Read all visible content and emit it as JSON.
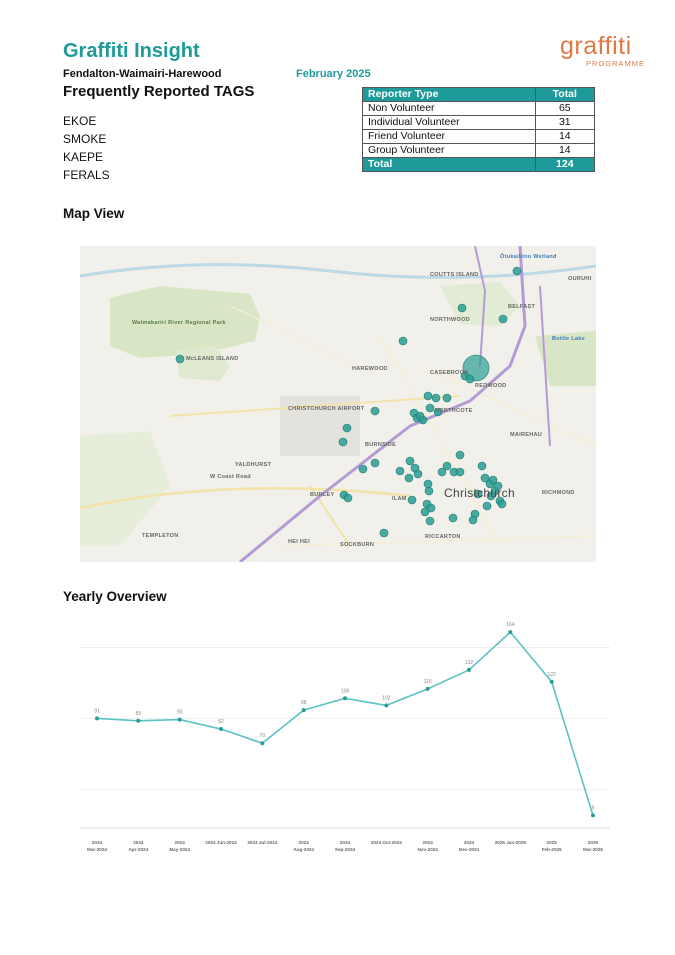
{
  "header": {
    "title": "Graffiti Insight",
    "area": "Fendalton-Waimairi-Harewood",
    "month": "February 2025",
    "logo_word": "graffiti",
    "logo_sub": "PROGRAMME"
  },
  "tags": {
    "heading": "Frequently Reported TAGS",
    "items": [
      "EKOE",
      "SMOKE",
      "KAEPE",
      "FERALS"
    ]
  },
  "reporter_table": {
    "headers": [
      "Reporter Type",
      "Total"
    ],
    "rows": [
      {
        "type": "Non Volunteer",
        "total": "65"
      },
      {
        "type": "Individual Volunteer",
        "total": "31"
      },
      {
        "type": "Friend Volunteer",
        "total": "14"
      },
      {
        "type": "Group Volunteer",
        "total": "14"
      }
    ],
    "total_label": "Total",
    "total_value": "124"
  },
  "map_section": {
    "heading": "Map View",
    "labels": [
      "Ōtukaikino Wetland",
      "COUTTS ISLAND",
      "OURUHI",
      "BELFAST",
      "NORTHWOOD",
      "Waimakariri River Regional Park",
      "Bottle Lake",
      "McLEANS ISLAND",
      "HAREWOOD",
      "CASEBROOK",
      "REDWOOD",
      "CHRISTCHURCH AIRPORT",
      "NORTHCOTE",
      "MAIREHAU",
      "BURNSIDE",
      "YALDHURST",
      "W Coast Road",
      "ILAM",
      "Christchurch",
      "RICHMOND",
      "BURLEY",
      "TEMPLETON",
      "HEI HEI",
      "SOCKBURN",
      "RICCARTON"
    ],
    "colors": {
      "marker": "#2a9d94",
      "motorway": "#b59bd6",
      "park": "#d8e6c5",
      "water": "#bcd9e8"
    }
  },
  "yearly_section": {
    "heading": "Yearly Overview"
  },
  "chart_data": {
    "type": "line",
    "categories": [
      "2024 Mar-2024",
      "2024 Apr-2024",
      "2024 May-2024",
      "2024 Jun-2024",
      "2024 Jul-2024",
      "2024 Aug-2024",
      "2024 Sep-2024",
      "2024 Oct-2024",
      "2024 Nov-2024",
      "2024 Dec-2024",
      "2025 Jan-2025",
      "2025 Feb-2025",
      "2025 Mar-2025"
    ],
    "tick_labels": [
      [
        "2024",
        "Mar-2024"
      ],
      [
        "2024",
        "Apr-2024"
      ],
      [
        "2024",
        "May-2024"
      ],
      [
        "2024 Jun-2024"
      ],
      [
        "2024 Jul-2024"
      ],
      [
        "2024",
        "Aug-2024"
      ],
      [
        "2024",
        "Sep-2024"
      ],
      [
        "2024 Oct-2024"
      ],
      [
        "2024",
        "Nov-2024"
      ],
      [
        "2024",
        "Dec-2024"
      ],
      [
        "2025 Jan-2025"
      ],
      [
        "2025",
        "Feb-2025"
      ],
      [
        "2025",
        "Mar-2025"
      ]
    ],
    "values": [
      91,
      89,
      90,
      82,
      70,
      98,
      108,
      102,
      116,
      132,
      164,
      122,
      9
    ],
    "ylim": [
      0,
      170
    ],
    "grid": true,
    "color": "#5bc2c4"
  }
}
